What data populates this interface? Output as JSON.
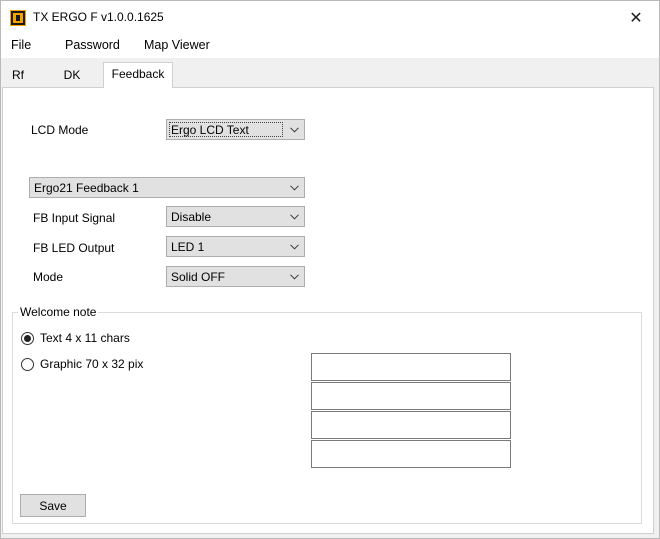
{
  "window": {
    "title": "TX ERGO F v1.0.0.1625",
    "icon": "app-logo-icon",
    "close_icon": "close-icon"
  },
  "menu": {
    "items": [
      "File",
      "Password",
      "Map Viewer"
    ]
  },
  "tabs": {
    "items": [
      "Rf",
      "DK",
      "Feedback"
    ],
    "active": "Feedback"
  },
  "feedback": {
    "lcd_mode_label": "LCD Mode",
    "lcd_mode_value": "Ergo LCD Text",
    "feedback_select_value": "Ergo21 Feedback 1",
    "fb_input_label": "FB Input Signal",
    "fb_input_value": "Disable",
    "fb_led_label": "FB LED Output",
    "fb_led_value": "LED 1",
    "mode_label": "Mode",
    "mode_value": "Solid OFF"
  },
  "welcome": {
    "group_title": "Welcome note",
    "option_text": "Text 4 x 11 chars",
    "option_graphic": "Graphic 70 x 32 pix",
    "selected": "text",
    "lines": [
      "",
      "",
      "",
      ""
    ]
  },
  "actions": {
    "save_label": "Save"
  }
}
